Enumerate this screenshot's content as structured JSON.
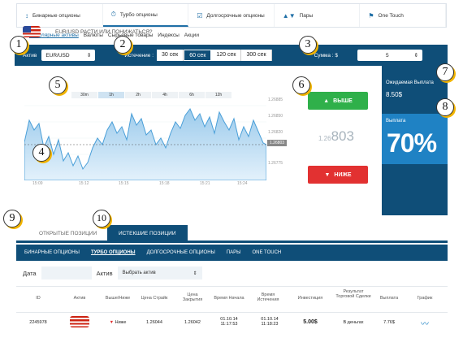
{
  "topnav": [
    {
      "icon": "↕",
      "label": "Бинарные опционы"
    },
    {
      "icon": "⏱",
      "label": "Турбо опционы"
    },
    {
      "icon": "☑",
      "label": "Долгосрочные опционы"
    },
    {
      "icon": "▲▼",
      "label": "Пары"
    },
    {
      "icon": "⚑",
      "label": "One Touch"
    }
  ],
  "subnav": [
    "Популярные активы",
    "Валюты",
    "Сырьевые товары",
    "Индексы",
    "Акции"
  ],
  "controls": {
    "asset_label": "Актив",
    "asset_value": "EUR/USD",
    "expiry_label": "Истечение :",
    "expiry_options": [
      "30 сек",
      "60 сек",
      "120 сек",
      "300 сек"
    ],
    "amount_label": "Сумма : $",
    "amount_value": "5"
  },
  "question": "EUR/USD РАСТИ ИЛИ ПОНИЖАТЬСЯ?",
  "periods": [
    "30m",
    "1h",
    "2h",
    "4h",
    "6h",
    "12h"
  ],
  "y_ticks": [
    "1.26885",
    "1.26850",
    "1.26820",
    "1.26803",
    "1.26775"
  ],
  "x_ticks": [
    "15:09",
    "15:12",
    "15:15",
    "15:18",
    "15:21",
    "15:24"
  ],
  "current_price_tag": "1.26803",
  "big_price": {
    "prefix": "1.26",
    "main": "803"
  },
  "up_button": "ВЫШЕ",
  "down_button": "НИЖЕ",
  "expected_payout": {
    "label": "Ожидаемая Выплата",
    "value": "8.50$"
  },
  "payout": {
    "label": "Выплата",
    "value": "70%"
  },
  "position_tabs": [
    "ОТКРЫТЫЕ ПОЗИЦИИ",
    "ИСТЕКШИЕ ПОЗИЦИИ"
  ],
  "position_subtabs": [
    "БИНАРНЫЕ ОПЦИОНЫ",
    "ТУРБО ОПЦИОНЫ",
    "ДОЛГОСРОЧНЫЕ ОПЦИОНЫ",
    "ПАРЫ",
    "ONE TOUCH"
  ],
  "filters": {
    "date_label": "Дата",
    "asset_label": "Актив",
    "asset_select": "Выбрать актив"
  },
  "table_headers": [
    "ID",
    "Актив",
    "Выше/Ниже",
    "Цена Страйк",
    "Цена Закрытия",
    "Время Начала",
    "Время Истечения",
    "Инвестиция",
    "Результат Торговой Сделки",
    "Выплата",
    "График"
  ],
  "table_row": {
    "id": "2245978",
    "direction": "Ниже",
    "strike": "1.26044",
    "close": "1.26042",
    "start": "01.10.14 11:17:53",
    "expiry": "01.10.14 11:18:23",
    "investment": "5.00$",
    "result": "В деньгах",
    "payout": "7.76$"
  },
  "badges": [
    "1",
    "2",
    "3",
    "4",
    "5",
    "6",
    "7",
    "8",
    "9",
    "10"
  ],
  "colors": {
    "navy": "#0f4e78",
    "blue": "#1f82c4",
    "green": "#2fb04a",
    "red": "#e23131"
  }
}
